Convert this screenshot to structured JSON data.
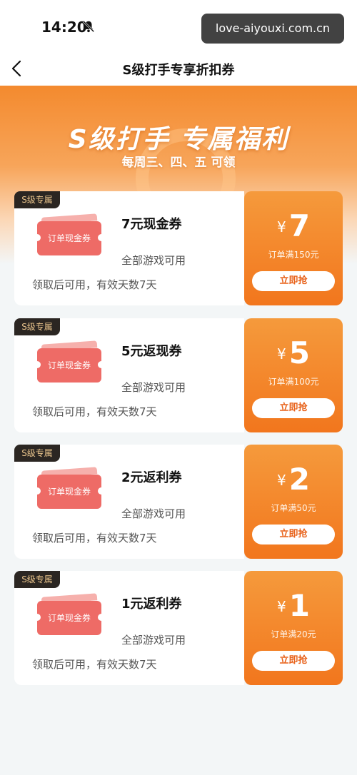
{
  "status_bar": {
    "time": "14:20"
  },
  "watermark": "love-aiyouxi.com.cn",
  "nav": {
    "title": "S级打手专享折扣券"
  },
  "banner": {
    "title": "S级打手 专属福利",
    "subtitle": "每周三、四、五 可领"
  },
  "coupons": [
    {
      "tag": "S级专属",
      "ticket_text": "订单现金券",
      "name": "7元现金券",
      "scope": "全部游戏可用",
      "validity": "领取后可用，有效天数7天",
      "currency": "¥",
      "amount": "7",
      "threshold": "订单满150元",
      "button": "立即抢"
    },
    {
      "tag": "S级专属",
      "ticket_text": "订单现金券",
      "name": "5元返现券",
      "scope": "全部游戏可用",
      "validity": "领取后可用，有效天数7天",
      "currency": "¥",
      "amount": "5",
      "threshold": "订单满100元",
      "button": "立即抢"
    },
    {
      "tag": "S级专属",
      "ticket_text": "订单现金券",
      "name": "2元返利券",
      "scope": "全部游戏可用",
      "validity": "领取后可用，有效天数7天",
      "currency": "¥",
      "amount": "2",
      "threshold": "订单满50元",
      "button": "立即抢"
    },
    {
      "tag": "S级专属",
      "ticket_text": "订单现金券",
      "name": "1元返利券",
      "scope": "全部游戏可用",
      "validity": "领取后可用，有效天数7天",
      "currency": "¥",
      "amount": "1",
      "threshold": "订单满20元",
      "button": "立即抢"
    }
  ],
  "colors": {
    "accent_orange": "#f2761d",
    "tag_bg": "#2b2622",
    "tag_text": "#e9c48c",
    "ticket_red": "#ee6b66"
  },
  "icons": {
    "back": "back-arrow-icon",
    "notification_muted": "bell-off-icon"
  }
}
